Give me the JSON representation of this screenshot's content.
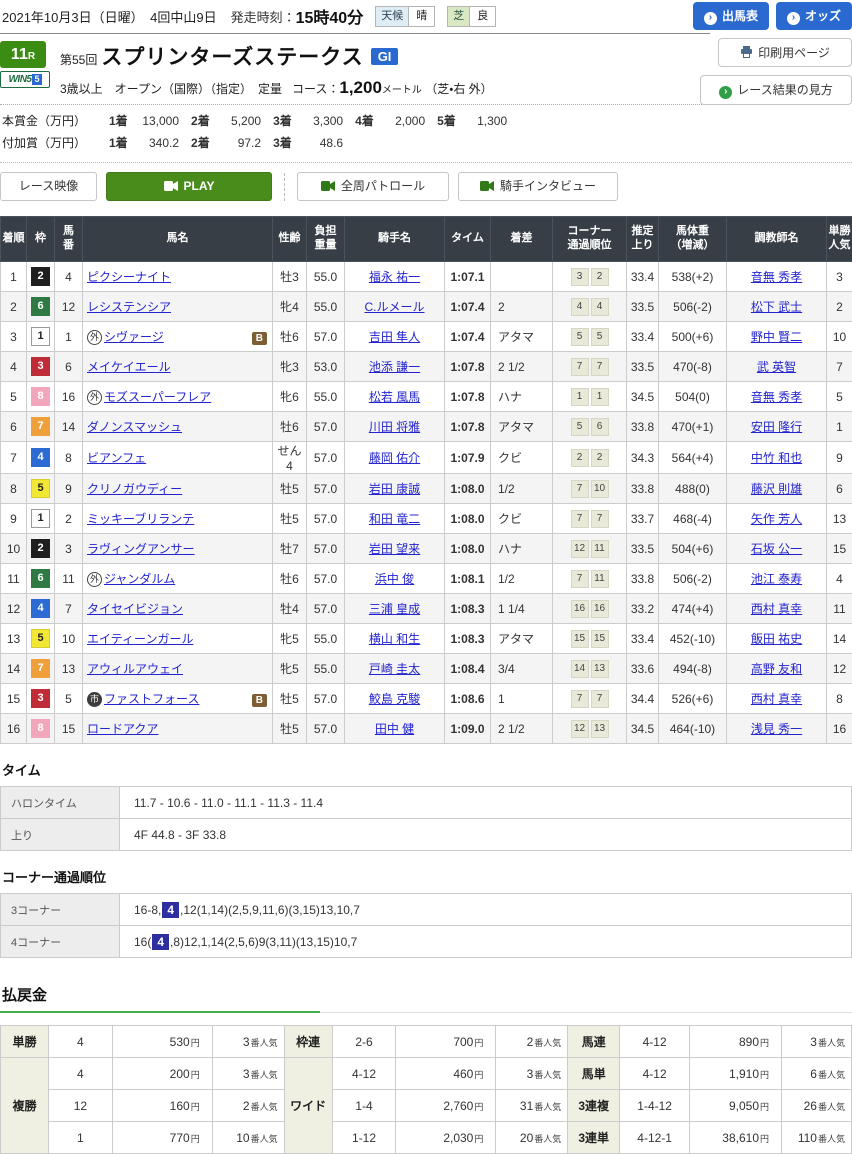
{
  "colors": {
    "accent_blue": "#2a6ad0",
    "race_green": "#3b8c12",
    "play_green": "#4a8c1c",
    "table_header_bg": "#373e46",
    "link": "#2424cf",
    "highlight_navy": "#2d2f9e",
    "payout_underline_green": "#3fae49",
    "frames": {
      "1": {
        "bg": "#ffffff",
        "fg": "#222222",
        "border": "#999999"
      },
      "2": {
        "bg": "#1f1f1f",
        "fg": "#ffffff",
        "border": "#1f1f1f"
      },
      "3": {
        "bg": "#bf2b36",
        "fg": "#ffffff",
        "border": "#bf2b36"
      },
      "4": {
        "bg": "#2c6bd3",
        "fg": "#ffffff",
        "border": "#2c6bd3"
      },
      "5": {
        "bg": "#f2e735",
        "fg": "#222222",
        "border": "#d8cd2a"
      },
      "6": {
        "bg": "#2f7a44",
        "fg": "#ffffff",
        "border": "#2f7a44"
      },
      "7": {
        "bg": "#f0a03a",
        "fg": "#ffffff",
        "border": "#f0a03a"
      },
      "8": {
        "bg": "#f2a6bb",
        "fg": "#ffffff",
        "border": "#f2a6bb"
      }
    }
  },
  "header": {
    "date_meeting": "2021年10月3日（日曜）　4回中山9日",
    "start_label": "発走時刻：",
    "start_time": "15時40分",
    "weather_label": "天候",
    "weather_value": "晴",
    "turf_label": "芝",
    "turf_value": "良",
    "entry_button": "出馬表",
    "odds_button": "オッズ",
    "print_button": "印刷用ページ",
    "guide_button": "レース結果の見方"
  },
  "race": {
    "number": "11",
    "r": "R",
    "win5_text": "WIN5",
    "win5_num": "5",
    "edition": "第55回",
    "title": "スプリンターズステークス",
    "grade": "GI",
    "conditions": "3歳以上　オープン（国際）（指定）　定量",
    "course_label": "コース：",
    "course_value": "1,200",
    "course_unit": "メートル",
    "course_detail": "（芝・右 外）"
  },
  "prize": {
    "main_label": "本賞金（万円）",
    "main": [
      {
        "place": "1着",
        "amount": "13,000"
      },
      {
        "place": "2着",
        "amount": "5,200"
      },
      {
        "place": "3着",
        "amount": "3,300"
      },
      {
        "place": "4着",
        "amount": "2,000"
      },
      {
        "place": "5着",
        "amount": "1,300"
      }
    ],
    "bonus_label": "付加賞（万円）",
    "bonus": [
      {
        "place": "1着",
        "amount": "340.2"
      },
      {
        "place": "2着",
        "amount": "97.2"
      },
      {
        "place": "3着",
        "amount": "48.6"
      }
    ]
  },
  "video": {
    "label": "レース映像",
    "play": "PLAY",
    "patrol": "全周パトロール",
    "interview": "騎手インタビュー"
  },
  "results": {
    "headers": [
      "着順",
      "枠",
      "馬\n番",
      "馬名",
      "性齢",
      "負担\n重量",
      "騎手名",
      "タイム",
      "着差",
      "コーナー\n通過順位",
      "推定\n上り",
      "馬体重\n（増減）",
      "調教師名",
      "単勝\n人気"
    ],
    "rows": [
      {
        "pos": "1",
        "frame": "2",
        "num": "4",
        "mark": "",
        "mark_filled": false,
        "name": "ピクシーナイト",
        "blinker": false,
        "sexage": "牡3",
        "weight": "55.0",
        "jockey": "福永 祐一",
        "time": "1:07.1",
        "margin": "",
        "c1": "3",
        "c2": "2",
        "agari": "33.4",
        "body": "538(+2)",
        "trainer": "音無 秀孝",
        "pop": "3"
      },
      {
        "pos": "2",
        "frame": "6",
        "num": "12",
        "mark": "",
        "mark_filled": false,
        "name": "レシステンシア",
        "blinker": false,
        "sexage": "牝4",
        "weight": "55.0",
        "jockey": "C.ルメール",
        "time": "1:07.4",
        "margin": "2",
        "c1": "4",
        "c2": "4",
        "agari": "33.5",
        "body": "506(-2)",
        "trainer": "松下 武士",
        "pop": "2"
      },
      {
        "pos": "3",
        "frame": "1",
        "num": "1",
        "mark": "外",
        "mark_filled": false,
        "name": "シヴァージ",
        "blinker": true,
        "sexage": "牡6",
        "weight": "57.0",
        "jockey": "吉田 隼人",
        "time": "1:07.4",
        "margin": "アタマ",
        "c1": "5",
        "c2": "5",
        "agari": "33.4",
        "body": "500(+6)",
        "trainer": "野中 賢二",
        "pop": "10"
      },
      {
        "pos": "4",
        "frame": "3",
        "num": "6",
        "mark": "",
        "mark_filled": false,
        "name": "メイケイエール",
        "blinker": false,
        "sexage": "牝3",
        "weight": "53.0",
        "jockey": "池添 謙一",
        "time": "1:07.8",
        "margin": "2 1/2",
        "c1": "7",
        "c2": "7",
        "agari": "33.5",
        "body": "470(-8)",
        "trainer": "武 英智",
        "pop": "7"
      },
      {
        "pos": "5",
        "frame": "8",
        "num": "16",
        "mark": "外",
        "mark_filled": false,
        "name": "モズスーパーフレア",
        "blinker": false,
        "sexage": "牝6",
        "weight": "55.0",
        "jockey": "松若 風馬",
        "time": "1:07.8",
        "margin": "ハナ",
        "c1": "1",
        "c2": "1",
        "agari": "34.5",
        "body": "504(0)",
        "trainer": "音無 秀孝",
        "pop": "5"
      },
      {
        "pos": "6",
        "frame": "7",
        "num": "14",
        "mark": "",
        "mark_filled": false,
        "name": "ダノンスマッシュ",
        "blinker": false,
        "sexage": "牡6",
        "weight": "57.0",
        "jockey": "川田 将雅",
        "time": "1:07.8",
        "margin": "アタマ",
        "c1": "5",
        "c2": "6",
        "agari": "33.8",
        "body": "470(+1)",
        "trainer": "安田 隆行",
        "pop": "1"
      },
      {
        "pos": "7",
        "frame": "4",
        "num": "8",
        "mark": "",
        "mark_filled": false,
        "name": "ビアンフェ",
        "blinker": false,
        "sexage": "せん4",
        "weight": "57.0",
        "jockey": "藤岡 佑介",
        "time": "1:07.9",
        "margin": "クビ",
        "c1": "2",
        "c2": "2",
        "agari": "34.3",
        "body": "564(+4)",
        "trainer": "中竹 和也",
        "pop": "9"
      },
      {
        "pos": "8",
        "frame": "5",
        "num": "9",
        "mark": "",
        "mark_filled": false,
        "name": "クリノガウディー",
        "blinker": false,
        "sexage": "牡5",
        "weight": "57.0",
        "jockey": "岩田 康誠",
        "time": "1:08.0",
        "margin": "1/2",
        "c1": "7",
        "c2": "10",
        "agari": "33.8",
        "body": "488(0)",
        "trainer": "藤沢 則雄",
        "pop": "6"
      },
      {
        "pos": "9",
        "frame": "1",
        "num": "2",
        "mark": "",
        "mark_filled": false,
        "name": "ミッキーブリランテ",
        "blinker": false,
        "sexage": "牡5",
        "weight": "57.0",
        "jockey": "和田 竜二",
        "time": "1:08.0",
        "margin": "クビ",
        "c1": "7",
        "c2": "7",
        "agari": "33.7",
        "body": "468(-4)",
        "trainer": "矢作 芳人",
        "pop": "13"
      },
      {
        "pos": "10",
        "frame": "2",
        "num": "3",
        "mark": "",
        "mark_filled": false,
        "name": "ラヴィングアンサー",
        "blinker": false,
        "sexage": "牡7",
        "weight": "57.0",
        "jockey": "岩田 望来",
        "time": "1:08.0",
        "margin": "ハナ",
        "c1": "12",
        "c2": "11",
        "agari": "33.5",
        "body": "504(+6)",
        "trainer": "石坂 公一",
        "pop": "15"
      },
      {
        "pos": "11",
        "frame": "6",
        "num": "11",
        "mark": "外",
        "mark_filled": false,
        "name": "ジャンダルム",
        "blinker": false,
        "sexage": "牡6",
        "weight": "57.0",
        "jockey": "浜中 俊",
        "time": "1:08.1",
        "margin": "1/2",
        "c1": "7",
        "c2": "11",
        "agari": "33.8",
        "body": "506(-2)",
        "trainer": "池江 泰寿",
        "pop": "4"
      },
      {
        "pos": "12",
        "frame": "4",
        "num": "7",
        "mark": "",
        "mark_filled": false,
        "name": "タイセイビジョン",
        "blinker": false,
        "sexage": "牡4",
        "weight": "57.0",
        "jockey": "三浦 皇成",
        "time": "1:08.3",
        "margin": "1 1/4",
        "c1": "16",
        "c2": "16",
        "agari": "33.2",
        "body": "474(+4)",
        "trainer": "西村 真幸",
        "pop": "11"
      },
      {
        "pos": "13",
        "frame": "5",
        "num": "10",
        "mark": "",
        "mark_filled": false,
        "name": "エイティーンガール",
        "blinker": false,
        "sexage": "牝5",
        "weight": "55.0",
        "jockey": "横山 和生",
        "time": "1:08.3",
        "margin": "アタマ",
        "c1": "15",
        "c2": "15",
        "agari": "33.4",
        "body": "452(-10)",
        "trainer": "飯田 祐史",
        "pop": "14"
      },
      {
        "pos": "14",
        "frame": "7",
        "num": "13",
        "mark": "",
        "mark_filled": false,
        "name": "アウィルアウェイ",
        "blinker": false,
        "sexage": "牝5",
        "weight": "55.0",
        "jockey": "戸崎 圭太",
        "time": "1:08.4",
        "margin": "3/4",
        "c1": "14",
        "c2": "13",
        "agari": "33.6",
        "body": "494(-8)",
        "trainer": "高野 友和",
        "pop": "12"
      },
      {
        "pos": "15",
        "frame": "3",
        "num": "5",
        "mark": "市",
        "mark_filled": true,
        "name": "ファストフォース",
        "blinker": true,
        "sexage": "牡5",
        "weight": "57.0",
        "jockey": "鮫島 克駿",
        "time": "1:08.6",
        "margin": "1",
        "c1": "7",
        "c2": "7",
        "agari": "34.4",
        "body": "526(+6)",
        "trainer": "西村 真幸",
        "pop": "8"
      },
      {
        "pos": "16",
        "frame": "8",
        "num": "15",
        "mark": "",
        "mark_filled": false,
        "name": "ロードアクア",
        "blinker": false,
        "sexage": "牡5",
        "weight": "57.0",
        "jockey": "田中 健",
        "time": "1:09.0",
        "margin": "2 1/2",
        "c1": "12",
        "c2": "13",
        "agari": "34.5",
        "body": "464(-10)",
        "trainer": "浅見 秀一",
        "pop": "16"
      }
    ]
  },
  "time_section": {
    "title": "タイム",
    "rows": [
      {
        "label": "ハロンタイム",
        "value": "11.7 - 10.6 - 11.0 - 11.1 - 11.3 - 11.4"
      },
      {
        "label": "上り",
        "value": "4F 44.8 - 3F 33.8"
      }
    ]
  },
  "corner_section": {
    "title": "コーナー通過順位",
    "rows": [
      {
        "label": "3コーナー",
        "pre": "16-8,",
        "highlight": "4",
        "post": ",12(1,14)(2,5,9,11,6)(3,15)13,10,7"
      },
      {
        "label": "4コーナー",
        "pre": "16(",
        "highlight": "4",
        "post": ",8)12,1,14(2,5,6)9(3,11)(13,15)10,7"
      }
    ]
  },
  "payout": {
    "title": "払戻金",
    "yen_suffix": "円",
    "pop_suffix": "番人気",
    "columns": [
      [
        {
          "type": "単勝",
          "rows": [
            {
              "combo": "4",
              "amount": "530",
              "pop": "3"
            }
          ]
        },
        {
          "type": "複勝",
          "rows": [
            {
              "combo": "4",
              "amount": "200",
              "pop": "3"
            },
            {
              "combo": "12",
              "amount": "160",
              "pop": "2"
            },
            {
              "combo": "1",
              "amount": "770",
              "pop": "10"
            }
          ]
        }
      ],
      [
        {
          "type": "枠連",
          "rows": [
            {
              "combo": "2-6",
              "amount": "700",
              "pop": "2"
            }
          ]
        },
        {
          "type": "ワイド",
          "rows": [
            {
              "combo": "4-12",
              "amount": "460",
              "pop": "3"
            },
            {
              "combo": "1-4",
              "amount": "2,760",
              "pop": "31"
            },
            {
              "combo": "1-12",
              "amount": "2,030",
              "pop": "20"
            }
          ]
        }
      ],
      [
        {
          "type": "馬連",
          "rows": [
            {
              "combo": "4-12",
              "amount": "890",
              "pop": "3"
            }
          ]
        },
        {
          "type": "馬単",
          "rows": [
            {
              "combo": "4-12",
              "amount": "1,910",
              "pop": "6"
            }
          ]
        },
        {
          "type": "3連複",
          "rows": [
            {
              "combo": "1-4-12",
              "amount": "9,050",
              "pop": "26"
            }
          ]
        },
        {
          "type": "3連単",
          "rows": [
            {
              "combo": "4-12-1",
              "amount": "38,610",
              "pop": "110"
            }
          ]
        }
      ]
    ]
  }
}
